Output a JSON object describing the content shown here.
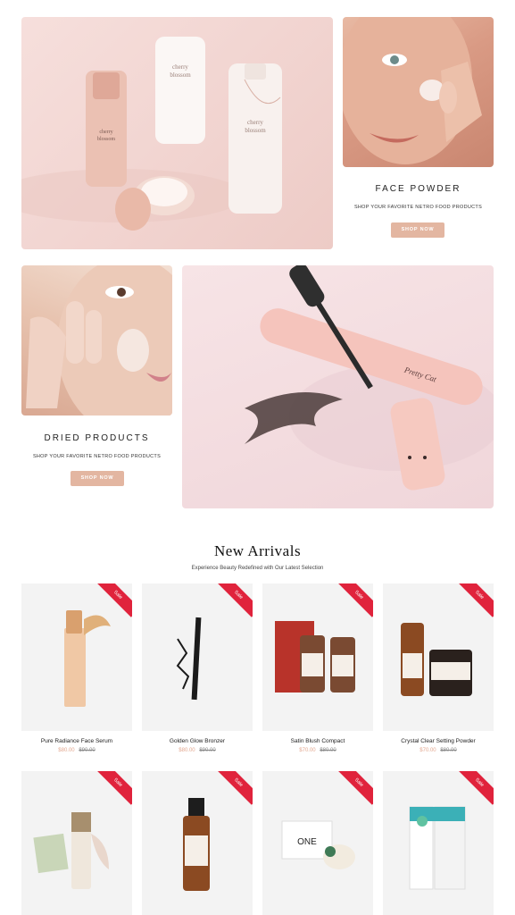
{
  "promos": [
    {
      "title": "FACE POWDER",
      "subtitle": "SHOP YOUR FAVORITE NETRO FOOD PRODUCTS",
      "button": "SHOP NOW"
    },
    {
      "title": "DRIED PRODUCTS",
      "subtitle": "SHOP YOUR FAVORITE NETRO FOOD PRODUCTS",
      "button": "SHOP NOW"
    }
  ],
  "hero_images": {
    "bottle_label": "cherry blossom",
    "tube_label": "cherry blossom",
    "mascara_label": "Pretty Cat"
  },
  "new_arrivals": {
    "title": "New Arrivals",
    "subtitle": "Experience Beauty Redefined with Our Latest Selection",
    "badge": "Sale",
    "products": [
      {
        "name": "Pure Radiance Face Serum",
        "price": "$80.00",
        "old_price": "$90.00"
      },
      {
        "name": "Golden Glow Bronzer",
        "price": "$80.00",
        "old_price": "$90.00"
      },
      {
        "name": "Satin Blush Compact",
        "price": "$70.00",
        "old_price": "$80.00"
      },
      {
        "name": "Crystal Clear Setting Powder",
        "price": "$70.00",
        "old_price": "$80.00"
      }
    ],
    "row2_labels": {
      "tin_label": "ONE"
    }
  }
}
